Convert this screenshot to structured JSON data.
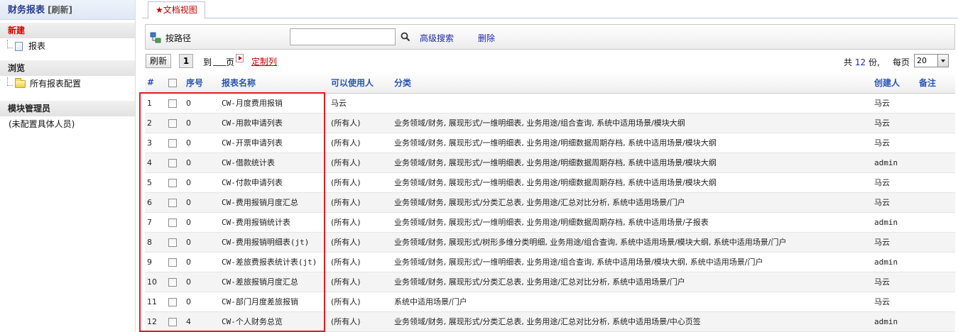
{
  "sidebar": {
    "title": "财务报表",
    "refresh": "[刷新]",
    "sections": {
      "new": "新建",
      "browse": "浏览",
      "admin": "模块管理员"
    },
    "new_item": "报表",
    "browse_item": "所有报表配置",
    "admin_note": "(未配置具体人员)"
  },
  "tab": {
    "label": "★文档视图"
  },
  "toolbar": {
    "path_label": "按路径",
    "search_value": "",
    "advanced_search": "高级搜索",
    "delete": "删除"
  },
  "pager": {
    "refresh": "刷新",
    "page": "1",
    "goto": "到",
    "page_unit": "页",
    "custom_columns": "定制列",
    "total_prefix": "共",
    "total_count": "12",
    "total_suffix": "份,",
    "per_page_label": "每页",
    "page_size": "20"
  },
  "table": {
    "columns": [
      "#",
      "",
      "序号",
      "报表名称",
      "可以使用人",
      "分类",
      "创建人",
      "备注"
    ],
    "rows": [
      {
        "idx": "1",
        "seq": "0",
        "name": "CW-月度费用报销",
        "users": "马云",
        "category": "",
        "creator": "马云",
        "note": ""
      },
      {
        "idx": "2",
        "seq": "0",
        "name": "CW-用款申请列表",
        "users": "(所有人)",
        "category": "业务领域/财务, 展现形式/一维明细表, 业务用途/组合查询, 系统中适用场景/模块大纲",
        "creator": "马云",
        "note": ""
      },
      {
        "idx": "3",
        "seq": "0",
        "name": "CW-开票申请列表",
        "users": "(所有人)",
        "category": "业务领域/财务, 展现形式/一维明细表, 业务用途/明细数据周期存档, 系统中适用场景/模块大纲",
        "creator": "马云",
        "note": ""
      },
      {
        "idx": "4",
        "seq": "0",
        "name": "CW-借款统计表",
        "users": "(所有人)",
        "category": "业务领域/财务, 展现形式/一维明细表, 业务用途/明细数据周期存档, 系统中适用场景/模块大纲",
        "creator": "admin",
        "note": ""
      },
      {
        "idx": "5",
        "seq": "0",
        "name": "CW-付款申请列表",
        "users": "(所有人)",
        "category": "业务领域/财务, 展现形式/一维明细表, 业务用途/明细数据周期存档, 系统中适用场景/模块大纲",
        "creator": "马云",
        "note": ""
      },
      {
        "idx": "6",
        "seq": "0",
        "name": "CW-费用报销月度汇总",
        "users": "(所有人)",
        "category": "业务领域/财务, 展现形式/分类汇总表, 业务用途/汇总对比分析, 系统中适用场景/门户",
        "creator": "马云",
        "note": ""
      },
      {
        "idx": "7",
        "seq": "0",
        "name": "CW-费用报销统计表",
        "users": "(所有人)",
        "category": "业务领域/财务, 展现形式/一维明细表, 业务用途/明细数据周期存档, 系统中适用场景/子报表",
        "creator": "admin",
        "note": ""
      },
      {
        "idx": "8",
        "seq": "0",
        "name": "CW-费用报销明细表(jt)",
        "users": "(所有人)",
        "category": "业务领域/财务, 展现形式/树形多维分类明细, 业务用途/组合查询, 系统中适用场景/模块大纲, 系统中适用场景/门户",
        "creator": "马云",
        "note": ""
      },
      {
        "idx": "9",
        "seq": "0",
        "name": "CW-差旅费报表统计表(jt)",
        "users": "(所有人)",
        "category": "业务领域/财务, 展现形式/一维明细表, 业务用途/组合查询, 系统中适用场景/模块大纲, 系统中适用场景/门户",
        "creator": "admin",
        "note": ""
      },
      {
        "idx": "10",
        "seq": "0",
        "name": "CW-差旅报销月度汇总",
        "users": "(所有人)",
        "category": "业务领域/财务, 展现形式/分类汇总表, 业务用途/汇总对比分析, 系统中适用场景/门户",
        "creator": "马云",
        "note": ""
      },
      {
        "idx": "11",
        "seq": "0",
        "name": "CW-部门月度差旅报销",
        "users": "(所有人)",
        "category": "系统中适用场景/门户",
        "creator": "马云",
        "note": ""
      },
      {
        "idx": "12",
        "seq": "4",
        "name": "CW-个人财务总览",
        "users": "(所有人)",
        "category": "业务领域/财务, 展现形式/分类汇总表, 业务用途/汇总对比分析, 系统中适用场景/中心页签",
        "creator": "admin",
        "note": ""
      }
    ]
  },
  "colors": {
    "link_blue": "#1c2aa8",
    "header_blue": "#2a54b4",
    "accent_red": "#c00000",
    "highlight_red": "#e8191d"
  }
}
